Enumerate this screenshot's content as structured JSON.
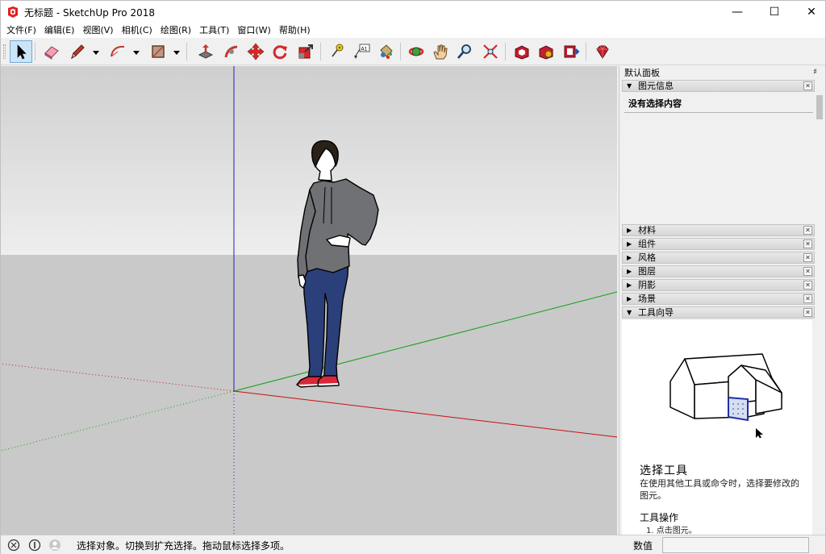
{
  "window": {
    "title": "无标题 - SketchUp Pro 2018",
    "minimize": "—",
    "maximize": "☐",
    "close": "✕"
  },
  "menu": [
    "文件(F)",
    "编辑(E)",
    "视图(V)",
    "相机(C)",
    "绘图(R)",
    "工具(T)",
    "窗口(W)",
    "帮助(H)"
  ],
  "toolbar": {
    "tools": [
      "select",
      "eraser",
      "pencil-line",
      "arc",
      "rectangle",
      "push-pull",
      "follow-me",
      "move",
      "rotate",
      "scale",
      "tape-measure",
      "text",
      "paint-bucket",
      "orbit",
      "pan",
      "zoom",
      "zoom-extents",
      "3d-warehouse",
      "extension-warehouse",
      "send-to-layout",
      "ruby-extension"
    ],
    "active_tool": "select"
  },
  "tray": {
    "title": "默认面板",
    "pin": "♯",
    "entity_info": {
      "label": "图元信息",
      "body_text": "没有选择内容"
    },
    "sections": [
      "材料",
      "组件",
      "风格",
      "图层",
      "阴影",
      "场景"
    ],
    "instructor": {
      "label": "工具向导",
      "tool_title": "选择工具",
      "description": "在使用其他工具或命令时，选择要修改的图元。",
      "operations_title": "工具操作",
      "step": "1. 点击图元。"
    }
  },
  "status": {
    "text": "选择对象。切换到扩充选择。拖动鼠标选择多项。",
    "measurements_label": "数值",
    "measurements_value": ""
  },
  "colors": {
    "sky": "#d3d3d3",
    "ground": "#c8c8c8",
    "axis_red": "#cc0000",
    "axis_green": "#00aa00",
    "axis_blue": "#0000cc",
    "accent": "#cc1f2e"
  }
}
